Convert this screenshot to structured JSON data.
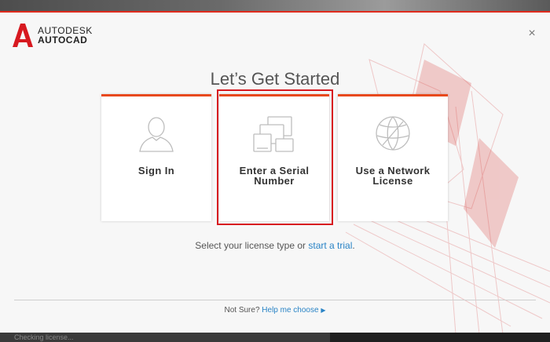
{
  "brand": {
    "company": "AUTODESK",
    "product": "AUTOCAD",
    "mark": "A"
  },
  "close_glyph": "×",
  "title": "Let’s Get Started",
  "cards": [
    {
      "label_line1": "Sign In",
      "label_line2": "",
      "icon": "user-icon"
    },
    {
      "label_line1": "Enter a Serial",
      "label_line2": "Number",
      "icon": "devices-icon"
    },
    {
      "label_line1": "Use a Network",
      "label_line2": "License",
      "icon": "globe-icon"
    }
  ],
  "select": {
    "text": "Select your license type or ",
    "link": "start a trial",
    "suffix": "."
  },
  "help": {
    "text": "Not Sure? ",
    "link": "Help me choose",
    "arrow": "▶"
  },
  "status": "Checking license...",
  "colors": {
    "accent": "#e8491d",
    "highlight": "#d71920",
    "link": "#2a84c6"
  }
}
